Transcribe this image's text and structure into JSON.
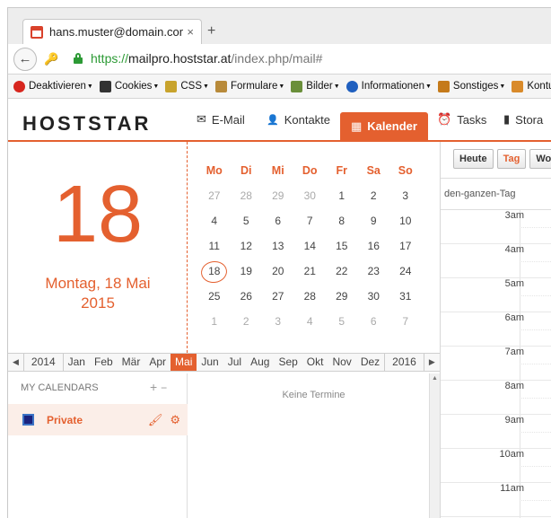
{
  "browser": {
    "tab_title": "hans.muster@domain.com",
    "tab_close": "×",
    "new_tab": "+",
    "url_scheme": "https://",
    "url_host": "mailpro.hoststar.at",
    "url_path": "/index.php/mail#",
    "bookmarks": [
      {
        "label": "Deaktivieren",
        "icon": "block-icon",
        "color": "#d7261e"
      },
      {
        "label": "Cookies",
        "icon": "person-icon",
        "color": "#333333"
      },
      {
        "label": "CSS",
        "icon": "pencil-icon",
        "color": "#c8a32c"
      },
      {
        "label": "Formulare",
        "icon": "clipboard-icon",
        "color": "#b88a3a"
      },
      {
        "label": "Bilder",
        "icon": "image-icon",
        "color": "#6a8f3a"
      },
      {
        "label": "Informationen",
        "icon": "info-icon",
        "color": "#1f5fbf"
      },
      {
        "label": "Sonstiges",
        "icon": "box-icon",
        "color": "#c57a1a"
      },
      {
        "label": "Kontur",
        "icon": "pencil-icon",
        "color": "#d98a2a"
      }
    ]
  },
  "app": {
    "logo": "HOSTSTAR",
    "accent": "#e4602f",
    "nav": [
      {
        "label": "E-Mail",
        "icon": "✉"
      },
      {
        "label": "Kontakte",
        "icon": "👤"
      },
      {
        "label": "Kalender",
        "icon": "▦"
      },
      {
        "label": "Tasks",
        "icon": "⏰"
      },
      {
        "label": "Stora",
        "icon": "▮"
      }
    ]
  },
  "bigdate": {
    "day": "18",
    "line1": "Montag, 18 Mai",
    "line2": "2015"
  },
  "minical": {
    "weekdays": [
      "Mo",
      "Di",
      "Mi",
      "Do",
      "Fr",
      "Sa",
      "So"
    ],
    "weeks": [
      [
        "27",
        "28",
        "29",
        "30",
        "1",
        "2",
        "3"
      ],
      [
        "4",
        "5",
        "6",
        "7",
        "8",
        "9",
        "10"
      ],
      [
        "11",
        "12",
        "13",
        "14",
        "15",
        "16",
        "17"
      ],
      [
        "18",
        "19",
        "20",
        "21",
        "22",
        "23",
        "24"
      ],
      [
        "25",
        "26",
        "27",
        "28",
        "29",
        "30",
        "31"
      ],
      [
        "1",
        "2",
        "3",
        "4",
        "5",
        "6",
        "7"
      ]
    ],
    "today": "18"
  },
  "monthbar": {
    "prev_year": "2014",
    "months": [
      "Jan",
      "Feb",
      "Mär",
      "Apr",
      "Mai",
      "Jun",
      "Jul",
      "Aug",
      "Sep",
      "Okt",
      "Nov",
      "Dez"
    ],
    "active": "Mai",
    "next_year": "2016"
  },
  "calendars": {
    "heading": "MY CALENDARS",
    "add": "+",
    "remove": "−",
    "items": [
      {
        "name": "Private",
        "color": "#1a237e"
      }
    ]
  },
  "events": {
    "empty_text": "Keine Termine"
  },
  "dayview": {
    "buttons": [
      "Heute",
      "Tag",
      "Wo"
    ],
    "active_button": "Tag",
    "allday_label": "den-ganzen-Tag",
    "hours": [
      "3am",
      "4am",
      "5am",
      "6am",
      "7am",
      "8am",
      "9am",
      "10am",
      "11am"
    ]
  }
}
